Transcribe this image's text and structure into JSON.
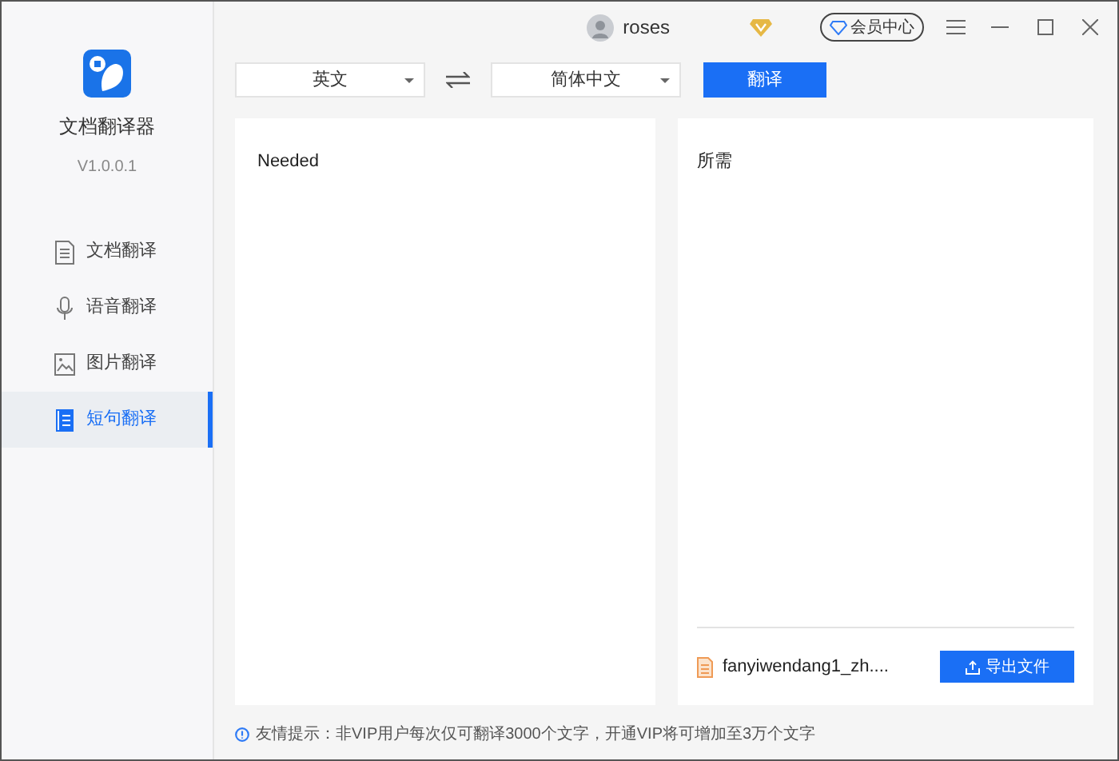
{
  "app": {
    "name": "文档翻译器",
    "version": "V1.0.0.1"
  },
  "sidebar": {
    "items": [
      {
        "kind": "document",
        "label": "文档翻译",
        "selected": false
      },
      {
        "kind": "voice",
        "label": "语音翻译",
        "selected": false
      },
      {
        "kind": "image",
        "label": "图片翻译",
        "selected": false
      },
      {
        "kind": "sentence",
        "label": "短句翻译",
        "selected": true
      }
    ]
  },
  "titlebar": {
    "username": "roses",
    "vip_button": "会员中心"
  },
  "toolbar": {
    "source_language": "英文",
    "target_language": "简体中文",
    "translate_button": "翻译"
  },
  "source_panel": {
    "text": "Needed"
  },
  "result_panel": {
    "text": "所需",
    "file_name": "fanyiwendang1_zh....",
    "export_button": "导出文件"
  },
  "tip": "友情提示：非VIP用户每次仅可翻译3000个文字，开通VIP将可增加至3万个文字"
}
